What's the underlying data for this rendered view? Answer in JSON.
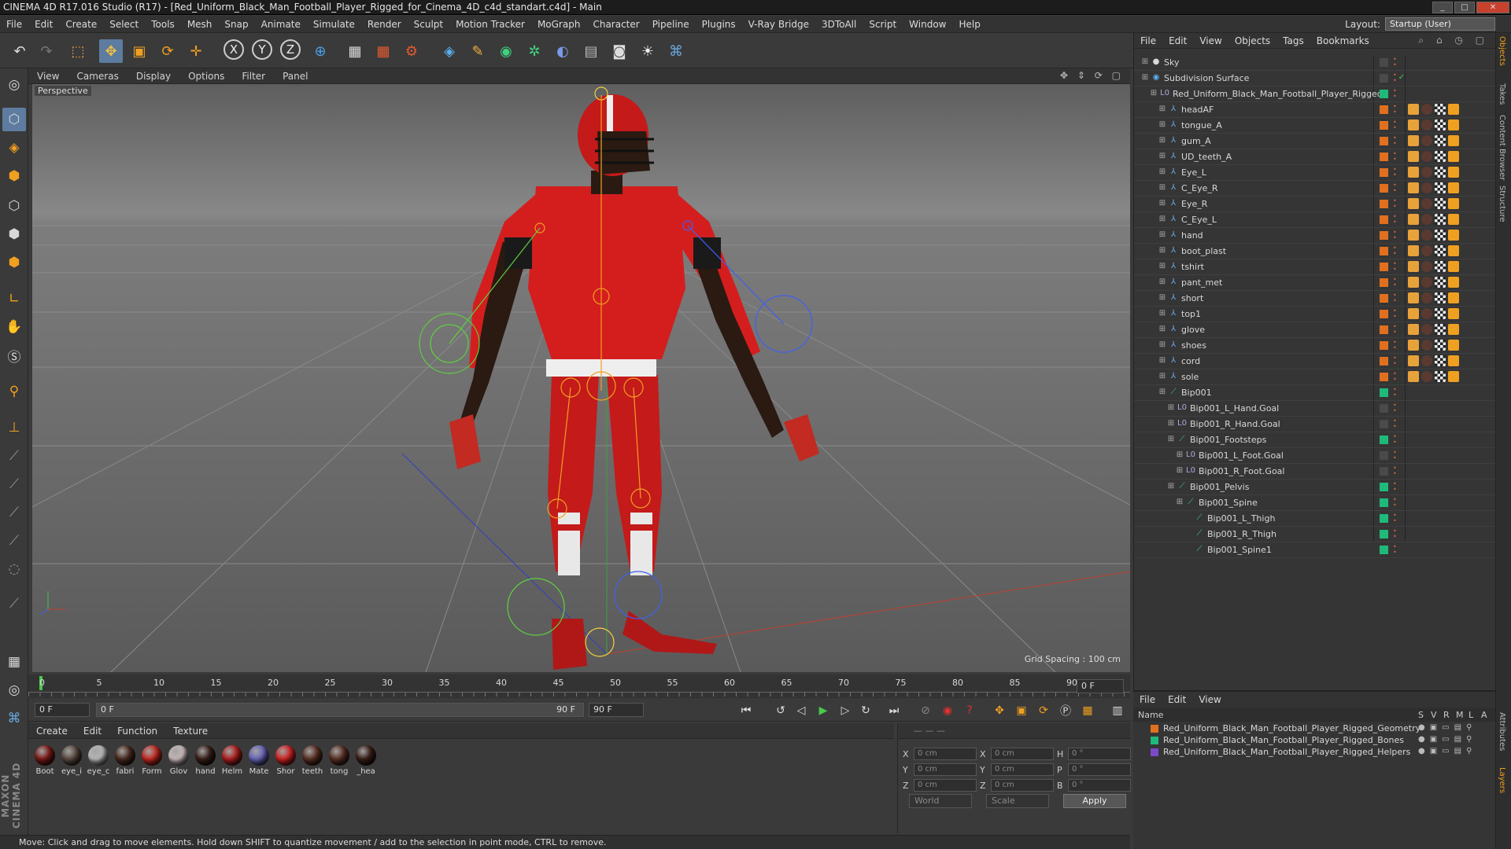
{
  "app": {
    "title": "CINEMA 4D R17.016 Studio (R17) - [Red_Uniform_Black_Man_Football_Player_Rigged_for_Cinema_4D_c4d_standart.c4d] - Main",
    "minimize": "_",
    "maximize": "□",
    "close": "✕"
  },
  "menu": [
    "File",
    "Edit",
    "Create",
    "Select",
    "Tools",
    "Mesh",
    "Snap",
    "Animate",
    "Simulate",
    "Render",
    "Sculpt",
    "Motion Tracker",
    "MoGraph",
    "Character",
    "Pipeline",
    "Plugins",
    "V-Ray Bridge",
    "3DToAll",
    "Script",
    "Window",
    "Help"
  ],
  "layout": {
    "label": "Layout:",
    "value": "Startup (User)"
  },
  "toolbar": {
    "icons": [
      "undo-icon",
      "redo-icon",
      "live-selection-icon",
      "move-icon",
      "scale-icon",
      "rotate-icon",
      "add-icon",
      "x-axis-icon",
      "y-axis-icon",
      "z-axis-icon",
      "world-coords-icon",
      "render-view-icon",
      "render-picture-queue-icon",
      "render-settings-icon",
      "cube-icon",
      "pen-icon",
      "nurbs-icon",
      "array-icon",
      "deformer-icon",
      "floor-icon",
      "camera-icon",
      "light-icon",
      "python-icon"
    ],
    "axis_x": "X",
    "axis_y": "Y",
    "axis_z": "Z"
  },
  "viewport": {
    "menu": [
      "View",
      "Cameras",
      "Display",
      "Options",
      "Filter",
      "Panel"
    ],
    "label": "Perspective",
    "grid_spacing": "Grid Spacing : 100 cm"
  },
  "timeline": {
    "ticks": [
      "0",
      "5",
      "10",
      "15",
      "20",
      "25",
      "30",
      "35",
      "40",
      "45",
      "50",
      "55",
      "60",
      "65",
      "70",
      "75",
      "80",
      "85",
      "90"
    ],
    "current_frame": "0 F",
    "start": "0 F",
    "slider_start": "0 F",
    "slider_end": "90 F",
    "end": "90 F",
    "end_frame": "90 F"
  },
  "materials": {
    "menu": [
      "Create",
      "Edit",
      "Function",
      "Texture"
    ],
    "items": [
      {
        "label": "Boot",
        "color": "#7a1a18"
      },
      {
        "label": "eye_i",
        "color": "#5a4a40"
      },
      {
        "label": "eye_c",
        "color": "#b8b8b8"
      },
      {
        "label": "fabri",
        "color": "#4a2a20"
      },
      {
        "label": "Form",
        "color": "#c42a22"
      },
      {
        "label": "Glov",
        "color": "#c8b8b8"
      },
      {
        "label": "hand",
        "color": "#3a2018"
      },
      {
        "label": "Helm",
        "color": "#b02020"
      },
      {
        "label": "Mate",
        "color": "#6a66b8"
      },
      {
        "label": "Shor",
        "color": "#d02424"
      },
      {
        "label": "teeth",
        "color": "#5a3024"
      },
      {
        "label": "tong",
        "color": "#5a3024"
      },
      {
        "label": "_hea",
        "color": "#3a2018"
      }
    ]
  },
  "coords": {
    "rows": [
      {
        "a": "X",
        "av": "0 cm",
        "b": "X",
        "bv": "0 cm",
        "c": "H",
        "cv": "0 °"
      },
      {
        "a": "Y",
        "av": "0 cm",
        "b": "Y",
        "bv": "0 cm",
        "c": "P",
        "cv": "0 °"
      },
      {
        "a": "Z",
        "av": "0 cm",
        "b": "Z",
        "bv": "0 cm",
        "c": "B",
        "cv": "0 °"
      }
    ],
    "mode1": "World",
    "mode2": "Scale",
    "apply": "Apply"
  },
  "status": "Move: Click and drag to move elements. Hold down SHIFT to quantize movement / add to the selection in point mode, CTRL to remove.",
  "objects": {
    "menu": [
      "File",
      "Edit",
      "View",
      "Objects",
      "Tags",
      "Bookmarks"
    ],
    "rows": [
      {
        "name": "Sky",
        "indent": 0,
        "type": "sky",
        "layer": "#4a4a4a"
      },
      {
        "name": "Subdivision Surface",
        "indent": 0,
        "type": "subd",
        "layer": "#4a4a4a"
      },
      {
        "name": "Red_Uniform_Black_Man_Football_Player_Rigged",
        "indent": 1,
        "type": "null",
        "layer": "#1fb97a"
      },
      {
        "name": "headAF",
        "indent": 2,
        "type": "mesh",
        "layer": "#e07020"
      },
      {
        "name": "tongue_A",
        "indent": 2,
        "type": "mesh",
        "layer": "#e07020"
      },
      {
        "name": "gum_A",
        "indent": 2,
        "type": "mesh",
        "layer": "#e07020"
      },
      {
        "name": "UD_teeth_A",
        "indent": 2,
        "type": "mesh",
        "layer": "#e07020"
      },
      {
        "name": "Eye_L",
        "indent": 2,
        "type": "mesh",
        "layer": "#e07020"
      },
      {
        "name": "C_Eye_R",
        "indent": 2,
        "type": "mesh",
        "layer": "#e07020"
      },
      {
        "name": "Eye_R",
        "indent": 2,
        "type": "mesh",
        "layer": "#e07020"
      },
      {
        "name": "C_Eye_L",
        "indent": 2,
        "type": "mesh",
        "layer": "#e07020"
      },
      {
        "name": "hand",
        "indent": 2,
        "type": "mesh",
        "layer": "#e07020"
      },
      {
        "name": "boot_plast",
        "indent": 2,
        "type": "mesh",
        "layer": "#e07020"
      },
      {
        "name": "tshirt",
        "indent": 2,
        "type": "mesh",
        "layer": "#e07020"
      },
      {
        "name": "pant_met",
        "indent": 2,
        "type": "mesh",
        "layer": "#e07020"
      },
      {
        "name": "short",
        "indent": 2,
        "type": "mesh",
        "layer": "#e07020"
      },
      {
        "name": "top1",
        "indent": 2,
        "type": "mesh",
        "layer": "#e07020"
      },
      {
        "name": "glove",
        "indent": 2,
        "type": "mesh",
        "layer": "#e07020"
      },
      {
        "name": "shoes",
        "indent": 2,
        "type": "mesh",
        "layer": "#e07020"
      },
      {
        "name": "cord",
        "indent": 2,
        "type": "mesh",
        "layer": "#e07020"
      },
      {
        "name": "sole",
        "indent": 2,
        "type": "mesh",
        "layer": "#e07020"
      },
      {
        "name": "Bip001",
        "indent": 2,
        "type": "bone",
        "layer": "#1fb97a"
      },
      {
        "name": "Bip001_L_Hand.Goal",
        "indent": 3,
        "type": "null",
        "layer": "#4a4a4a"
      },
      {
        "name": "Bip001_R_Hand.Goal",
        "indent": 3,
        "type": "null",
        "layer": "#4a4a4a"
      },
      {
        "name": "Bip001_Footsteps",
        "indent": 3,
        "type": "bone",
        "layer": "#1fb97a"
      },
      {
        "name": "Bip001_L_Foot.Goal",
        "indent": 4,
        "type": "null",
        "layer": "#4a4a4a"
      },
      {
        "name": "Bip001_R_Foot.Goal",
        "indent": 4,
        "type": "null",
        "layer": "#4a4a4a"
      },
      {
        "name": "Bip001_Pelvis",
        "indent": 3,
        "type": "bone",
        "layer": "#1fb97a"
      },
      {
        "name": "Bip001_Spine",
        "indent": 4,
        "type": "bone",
        "layer": "#1fb97a"
      },
      {
        "name": "Bip001_L_Thigh",
        "indent": 5,
        "type": "bone",
        "layer": "#1fb97a"
      },
      {
        "name": "Bip001_R_Thigh",
        "indent": 5,
        "type": "bone",
        "layer": "#1fb97a"
      },
      {
        "name": "Bip001_Spine1",
        "indent": 5,
        "type": "bone",
        "layer": "#1fb97a"
      }
    ]
  },
  "layers": {
    "menu": [
      "File",
      "Edit",
      "View"
    ],
    "header": {
      "name": "Name",
      "cols": [
        "S",
        "V",
        "R",
        "M",
        "L",
        "A"
      ]
    },
    "rows": [
      {
        "name": "Red_Uniform_Black_Man_Football_Player_Rigged_Geometry",
        "color": "#e07020"
      },
      {
        "name": "Red_Uniform_Black_Man_Football_Player_Rigged_Bones",
        "color": "#1fb97a"
      },
      {
        "name": "Red_Uniform_Black_Man_Football_Player_Rigged_Helpers",
        "color": "#7a4ac8"
      }
    ]
  },
  "right_tabs": [
    "Objects",
    "Takes",
    "Content Browser",
    "Structure",
    "Attributes",
    "Layers"
  ],
  "left_tools": [
    "model-mode-icon",
    "texture-mode-icon",
    "workplane-icon",
    "points-mode-icon",
    "edges-mode-icon",
    "polygons-mode-icon",
    "axis-mode-icon",
    "tweak-icon",
    "snap-icon",
    "magnet-icon",
    "locked-axis-icon",
    "bone-tool-icon",
    "ik-tool-icon",
    "joint-icon",
    "paint-icon",
    "brush-icon",
    "lasso-icon",
    "grid-tool-icon",
    "python-icon"
  ]
}
